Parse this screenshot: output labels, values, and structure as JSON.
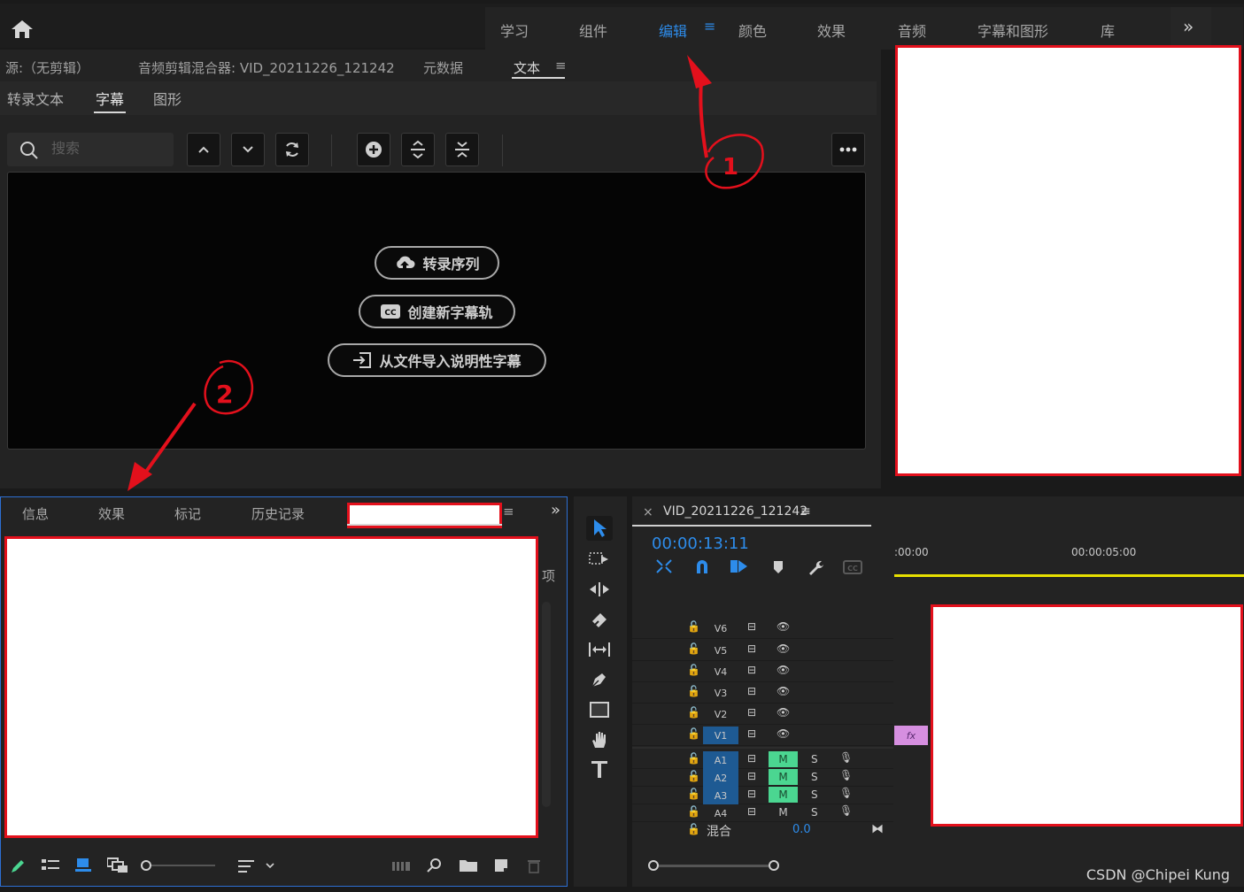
{
  "workspaces": {
    "tabs": [
      "学习",
      "组件",
      "编辑",
      "颜色",
      "效果",
      "音频",
      "字幕和图形",
      "库"
    ],
    "active": "编辑",
    "menu_glyph": "≡",
    "more_glyph": "»"
  },
  "source_panel": {
    "tabs": [
      "源:（无剪辑）",
      "音频剪辑混合器: VID_20211226_121242",
      "元数据",
      "文本"
    ],
    "active_tab": "文本",
    "menu_glyph": "≡",
    "subtabs": [
      "转录文本",
      "字幕",
      "图形"
    ],
    "active_subtab": "字幕",
    "search_placeholder": "搜索",
    "actions": [
      "转录序列",
      "创建新字幕轨",
      "从文件导入说明性字幕"
    ]
  },
  "bottom_left_panel": {
    "tabs": [
      "信息",
      "效果",
      "标记",
      "历史记录"
    ],
    "menu_glyph": "≡",
    "more_glyph": "»",
    "side_label": "项"
  },
  "timeline": {
    "sequence_name": "VID_20211226_121242",
    "close_glyph": "×",
    "menu_glyph": "≡",
    "timecode": "00:00:13:11",
    "ruler_labels": [
      ":00:00",
      "00:00:05:00"
    ],
    "video_tracks": [
      "V6",
      "V5",
      "V4",
      "V3",
      "V2",
      "V1"
    ],
    "audio_tracks": [
      "A1",
      "A2",
      "A3",
      "A4"
    ],
    "mute_label": "M",
    "solo_label": "S",
    "mix_label": "混合",
    "mix_value": "0.0",
    "clip_label": "fx"
  },
  "annotations": {
    "one": "1",
    "two": "2"
  },
  "watermark": "CSDN @Chipei Kung",
  "colors": {
    "accent": "#2d8ceb",
    "annotation_red": "#e3101c",
    "playhead_yellow": "#e8e000",
    "mute_green": "#4bd691",
    "track_blue": "#1e5a93",
    "clip_pink": "#d68fe0"
  }
}
